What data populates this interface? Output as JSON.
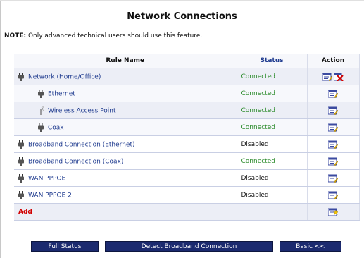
{
  "page": {
    "title": "Network Connections",
    "note_label": "NOTE:",
    "note_text": " Only advanced technical users should use this feature."
  },
  "table": {
    "columns": [
      "Rule Name",
      "Status",
      "Action"
    ],
    "rows": [
      {
        "name": "Network (Home/Office)",
        "status": "Connected",
        "icon": "plug-icon",
        "actions": [
          "edit-icon",
          "delete-icon"
        ]
      },
      {
        "name": "Ethernet",
        "status": "Connected",
        "icon": "plug-icon",
        "actions": [
          "edit-icon"
        ]
      },
      {
        "name": "Wireless Access Point",
        "status": "Connected",
        "icon": "wireless-icon",
        "actions": [
          "edit-icon"
        ]
      },
      {
        "name": "Coax",
        "status": "Connected",
        "icon": "plug-icon",
        "actions": [
          "edit-icon"
        ]
      },
      {
        "name": "Broadband Connection (Ethernet)",
        "status": "Disabled",
        "icon": "plug-icon",
        "actions": [
          "edit-icon"
        ]
      },
      {
        "name": "Broadband Connection (Coax)",
        "status": "Connected",
        "icon": "plug-icon",
        "actions": [
          "edit-icon"
        ]
      },
      {
        "name": "WAN PPPOE",
        "status": "Disabled",
        "icon": "plug-icon",
        "actions": [
          "edit-icon"
        ]
      },
      {
        "name": "WAN PPPOE 2",
        "status": "Disabled",
        "icon": "plug-icon",
        "actions": [
          "edit-icon"
        ]
      }
    ],
    "add_label": "Add",
    "add_icon": "add-icon"
  },
  "buttons": {
    "full_status": "Full Status",
    "detect": "Detect Broadband Connection",
    "basic": "Basic <<"
  },
  "colors": {
    "link": "#1f3b8f",
    "connected": "#2a8a2a",
    "add": "#d10000",
    "button_bg": "#1b2a6f"
  }
}
